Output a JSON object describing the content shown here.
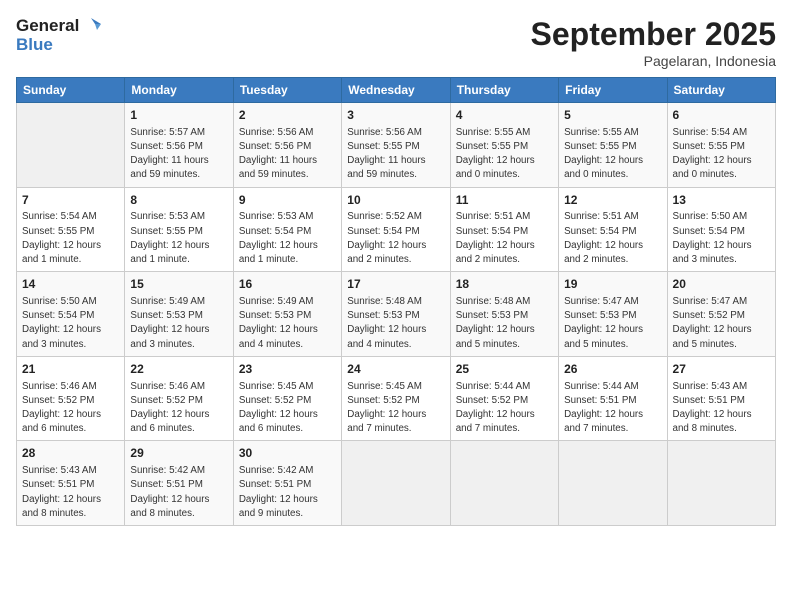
{
  "header": {
    "logo_line1": "General",
    "logo_line2": "Blue",
    "month": "September 2025",
    "location": "Pagelaran, Indonesia"
  },
  "days_of_week": [
    "Sunday",
    "Monday",
    "Tuesday",
    "Wednesday",
    "Thursday",
    "Friday",
    "Saturday"
  ],
  "weeks": [
    [
      {
        "day": "",
        "info": ""
      },
      {
        "day": "1",
        "info": "Sunrise: 5:57 AM\nSunset: 5:56 PM\nDaylight: 11 hours\nand 59 minutes."
      },
      {
        "day": "2",
        "info": "Sunrise: 5:56 AM\nSunset: 5:56 PM\nDaylight: 11 hours\nand 59 minutes."
      },
      {
        "day": "3",
        "info": "Sunrise: 5:56 AM\nSunset: 5:55 PM\nDaylight: 11 hours\nand 59 minutes."
      },
      {
        "day": "4",
        "info": "Sunrise: 5:55 AM\nSunset: 5:55 PM\nDaylight: 12 hours\nand 0 minutes."
      },
      {
        "day": "5",
        "info": "Sunrise: 5:55 AM\nSunset: 5:55 PM\nDaylight: 12 hours\nand 0 minutes."
      },
      {
        "day": "6",
        "info": "Sunrise: 5:54 AM\nSunset: 5:55 PM\nDaylight: 12 hours\nand 0 minutes."
      }
    ],
    [
      {
        "day": "7",
        "info": "Sunrise: 5:54 AM\nSunset: 5:55 PM\nDaylight: 12 hours\nand 1 minute."
      },
      {
        "day": "8",
        "info": "Sunrise: 5:53 AM\nSunset: 5:55 PM\nDaylight: 12 hours\nand 1 minute."
      },
      {
        "day": "9",
        "info": "Sunrise: 5:53 AM\nSunset: 5:54 PM\nDaylight: 12 hours\nand 1 minute."
      },
      {
        "day": "10",
        "info": "Sunrise: 5:52 AM\nSunset: 5:54 PM\nDaylight: 12 hours\nand 2 minutes."
      },
      {
        "day": "11",
        "info": "Sunrise: 5:51 AM\nSunset: 5:54 PM\nDaylight: 12 hours\nand 2 minutes."
      },
      {
        "day": "12",
        "info": "Sunrise: 5:51 AM\nSunset: 5:54 PM\nDaylight: 12 hours\nand 2 minutes."
      },
      {
        "day": "13",
        "info": "Sunrise: 5:50 AM\nSunset: 5:54 PM\nDaylight: 12 hours\nand 3 minutes."
      }
    ],
    [
      {
        "day": "14",
        "info": "Sunrise: 5:50 AM\nSunset: 5:54 PM\nDaylight: 12 hours\nand 3 minutes."
      },
      {
        "day": "15",
        "info": "Sunrise: 5:49 AM\nSunset: 5:53 PM\nDaylight: 12 hours\nand 3 minutes."
      },
      {
        "day": "16",
        "info": "Sunrise: 5:49 AM\nSunset: 5:53 PM\nDaylight: 12 hours\nand 4 minutes."
      },
      {
        "day": "17",
        "info": "Sunrise: 5:48 AM\nSunset: 5:53 PM\nDaylight: 12 hours\nand 4 minutes."
      },
      {
        "day": "18",
        "info": "Sunrise: 5:48 AM\nSunset: 5:53 PM\nDaylight: 12 hours\nand 5 minutes."
      },
      {
        "day": "19",
        "info": "Sunrise: 5:47 AM\nSunset: 5:53 PM\nDaylight: 12 hours\nand 5 minutes."
      },
      {
        "day": "20",
        "info": "Sunrise: 5:47 AM\nSunset: 5:52 PM\nDaylight: 12 hours\nand 5 minutes."
      }
    ],
    [
      {
        "day": "21",
        "info": "Sunrise: 5:46 AM\nSunset: 5:52 PM\nDaylight: 12 hours\nand 6 minutes."
      },
      {
        "day": "22",
        "info": "Sunrise: 5:46 AM\nSunset: 5:52 PM\nDaylight: 12 hours\nand 6 minutes."
      },
      {
        "day": "23",
        "info": "Sunrise: 5:45 AM\nSunset: 5:52 PM\nDaylight: 12 hours\nand 6 minutes."
      },
      {
        "day": "24",
        "info": "Sunrise: 5:45 AM\nSunset: 5:52 PM\nDaylight: 12 hours\nand 7 minutes."
      },
      {
        "day": "25",
        "info": "Sunrise: 5:44 AM\nSunset: 5:52 PM\nDaylight: 12 hours\nand 7 minutes."
      },
      {
        "day": "26",
        "info": "Sunrise: 5:44 AM\nSunset: 5:51 PM\nDaylight: 12 hours\nand 7 minutes."
      },
      {
        "day": "27",
        "info": "Sunrise: 5:43 AM\nSunset: 5:51 PM\nDaylight: 12 hours\nand 8 minutes."
      }
    ],
    [
      {
        "day": "28",
        "info": "Sunrise: 5:43 AM\nSunset: 5:51 PM\nDaylight: 12 hours\nand 8 minutes."
      },
      {
        "day": "29",
        "info": "Sunrise: 5:42 AM\nSunset: 5:51 PM\nDaylight: 12 hours\nand 8 minutes."
      },
      {
        "day": "30",
        "info": "Sunrise: 5:42 AM\nSunset: 5:51 PM\nDaylight: 12 hours\nand 9 minutes."
      },
      {
        "day": "",
        "info": ""
      },
      {
        "day": "",
        "info": ""
      },
      {
        "day": "",
        "info": ""
      },
      {
        "day": "",
        "info": ""
      }
    ]
  ]
}
